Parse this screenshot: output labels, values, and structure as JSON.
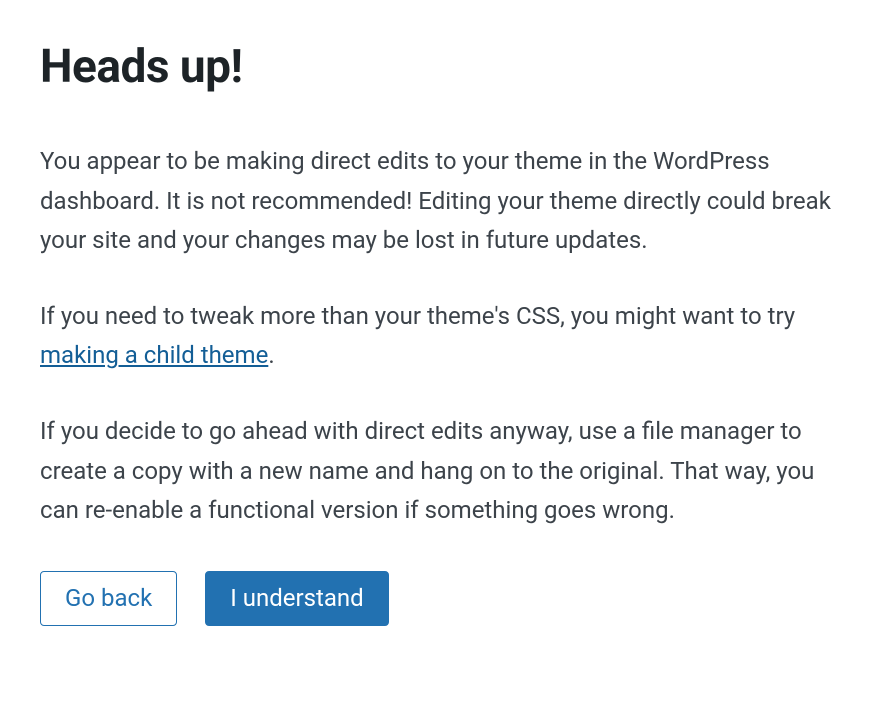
{
  "dialog": {
    "title": "Heads up!",
    "paragraph1": "You appear to be making direct edits to your theme in the WordPress dashboard. It is not recommended! Editing your theme directly could break your site and your changes may be lost in future updates.",
    "paragraph2_pre": "If you need to tweak more than your theme's CSS, you might want to try ",
    "paragraph2_link": "making a child theme",
    "paragraph2_post": ".",
    "paragraph3": "If you decide to go ahead with direct edits anyway, use a file manager to create a copy with a new name and hang on to the original. That way, you can re-enable a functional version if something goes wrong.",
    "actions": {
      "back_label": "Go back",
      "confirm_label": "I understand"
    }
  }
}
